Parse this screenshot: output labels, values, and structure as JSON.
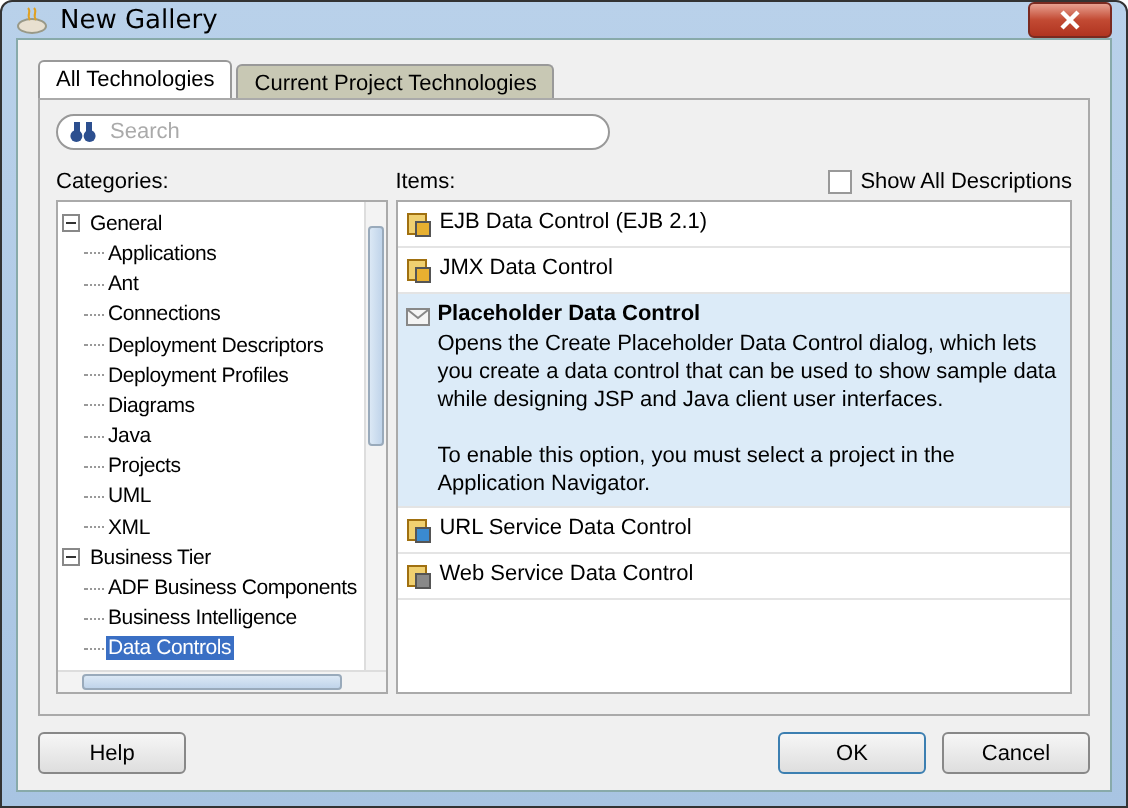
{
  "window": {
    "title": "New Gallery"
  },
  "tabs": [
    {
      "label": "All Technologies",
      "selected": true
    },
    {
      "label": "Current Project Technologies",
      "selected": false
    }
  ],
  "search": {
    "placeholder": "Search"
  },
  "categories": {
    "label": "Categories:",
    "tree": [
      {
        "label": "General",
        "expanded": true,
        "selected": false,
        "children": [
          {
            "label": "Applications",
            "selected": false
          },
          {
            "label": "Ant",
            "selected": false
          },
          {
            "label": "Connections",
            "selected": false
          },
          {
            "label": "Deployment Descriptors",
            "selected": false
          },
          {
            "label": "Deployment Profiles",
            "selected": false
          },
          {
            "label": "Diagrams",
            "selected": false
          },
          {
            "label": "Java",
            "selected": false
          },
          {
            "label": "Projects",
            "selected": false
          },
          {
            "label": "UML",
            "selected": false
          },
          {
            "label": "XML",
            "selected": false
          }
        ]
      },
      {
        "label": "Business Tier",
        "expanded": true,
        "selected": false,
        "children": [
          {
            "label": "ADF Business Components",
            "selected": false
          },
          {
            "label": "Business Intelligence",
            "selected": false
          },
          {
            "label": "Data Controls",
            "selected": true
          }
        ]
      }
    ]
  },
  "items": {
    "label": "Items:",
    "show_all_descriptions": {
      "label": "Show All Descriptions",
      "checked": false
    },
    "list": [
      {
        "name": "EJB Data Control (EJB 2.1)",
        "selected": false
      },
      {
        "name": "JMX Data Control",
        "selected": false
      },
      {
        "name": "Placeholder Data Control",
        "selected": true,
        "description": [
          "Opens the Create Placeholder Data Control dialog, which lets you create a data control that can be used to show sample data while designing JSP and Java client user interfaces.",
          "To enable this option, you must select a project in the Application Navigator."
        ]
      },
      {
        "name": "URL Service Data Control",
        "selected": false
      },
      {
        "name": "Web Service Data Control",
        "selected": false
      }
    ]
  },
  "buttons": {
    "help": "Help",
    "ok": "OK",
    "cancel": "Cancel"
  }
}
